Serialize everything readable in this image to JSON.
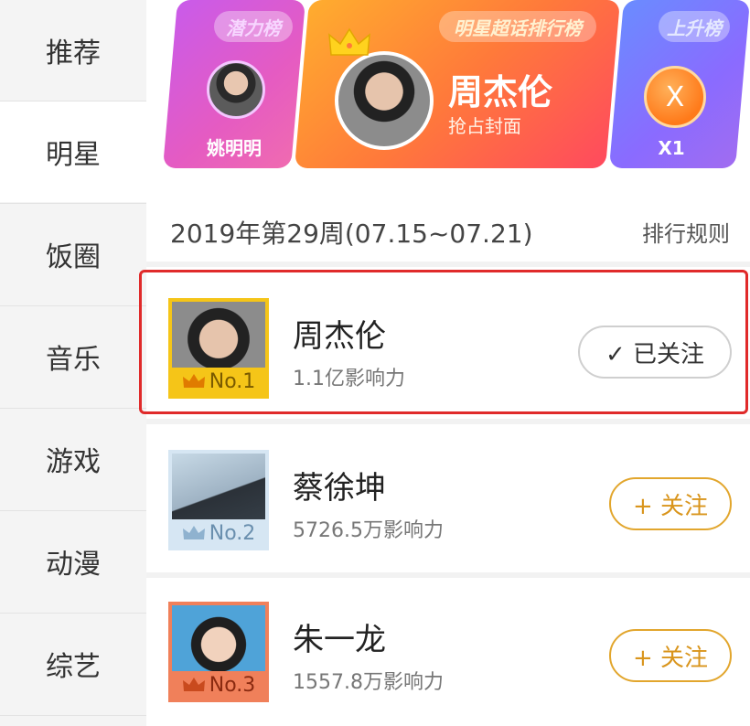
{
  "sidebar": {
    "items": [
      {
        "label": "推荐",
        "active": false
      },
      {
        "label": "明星",
        "active": true
      },
      {
        "label": "饭圈",
        "active": false
      },
      {
        "label": "音乐",
        "active": false
      },
      {
        "label": "游戏",
        "active": false
      },
      {
        "label": "动漫",
        "active": false
      },
      {
        "label": "综艺",
        "active": false
      }
    ]
  },
  "banner": {
    "cards": [
      {
        "tag": "潜力榜",
        "name": "姚明明"
      },
      {
        "tag": "明星超话排行榜",
        "name": "周杰伦",
        "subtitle": "抢占封面"
      },
      {
        "tag": "上升榜",
        "badge": "X",
        "name": "X1"
      }
    ]
  },
  "list": {
    "title": "2019年第29周(07.15~07.21)",
    "rules_link": "排行规则",
    "rows": [
      {
        "rank": "No.1",
        "name": "周杰伦",
        "influence": "1.1亿影响力",
        "follow_label": "✓ 已关注",
        "followed": true,
        "rank_color": "#f5c518"
      },
      {
        "rank": "No.2",
        "name": "蔡徐坤",
        "influence": "5726.5万影响力",
        "follow_label": "+ 关注",
        "followed": false,
        "rank_color": "#a9c9e4"
      },
      {
        "rank": "No.3",
        "name": "朱一龙",
        "influence": "1557.8万影响力",
        "follow_label": "+ 关注",
        "followed": false,
        "rank_color": "#f0805a"
      }
    ]
  },
  "colors": {
    "highlight": "#e02a2a",
    "follow_accent": "#d9951c"
  }
}
